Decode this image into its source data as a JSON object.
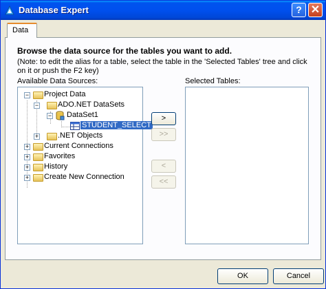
{
  "window": {
    "title": "Database Expert",
    "help_glyph": "?",
    "close_glyph": "✕"
  },
  "tabs": [
    {
      "label": "Data"
    }
  ],
  "panel": {
    "heading": "Browse the data source for the tables you want to add.",
    "note": "(Note: to edit the alias for a table, select the table in the 'Selected Tables' tree and click on it or push the F2 key)",
    "available_label": "Available Data Sources:",
    "selected_label": "Selected Tables:"
  },
  "tree": {
    "project_data": "Project Data",
    "ado_datasets": "ADO.NET DataSets",
    "dataset1": "DataSet1",
    "student_select": "STUDENT_SELECT",
    "net_objects": ".NET Objects",
    "current_connections": "Current Connections",
    "favorites": "Favorites",
    "history": "History",
    "create_new_connection": "Create New Connection"
  },
  "move_buttons": {
    "add": ">",
    "add_all": ">>",
    "remove": "<",
    "remove_all": "<<"
  },
  "footer": {
    "ok": "OK",
    "cancel": "Cancel"
  },
  "colors": {
    "titlebar": "#0053ee",
    "selection": "#316ac5",
    "dialog_bg": "#ece9d8"
  }
}
